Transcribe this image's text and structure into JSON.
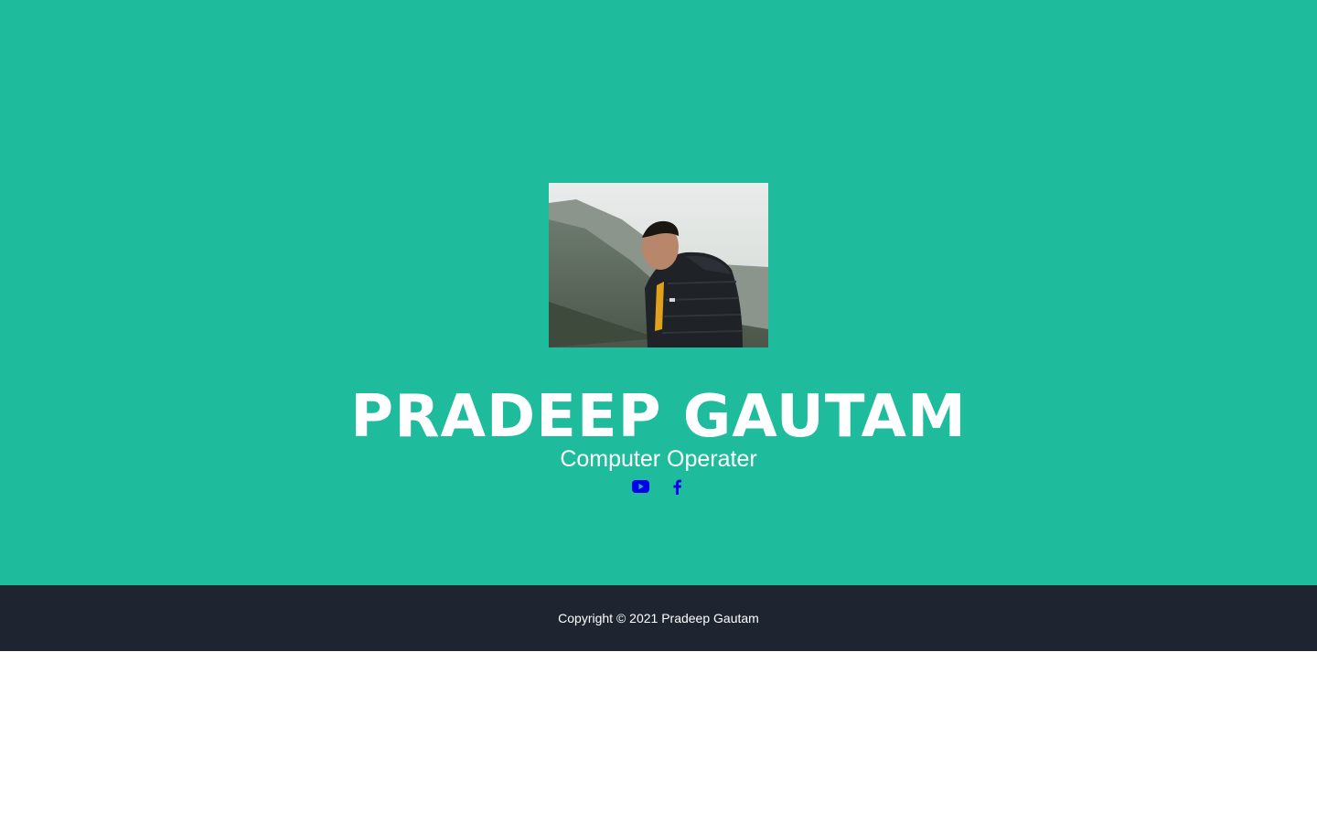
{
  "profile": {
    "photo_alt": "Profile photo",
    "name": "PRADEEP GAUTAM",
    "title": "Computer Operater"
  },
  "social": {
    "icons": [
      "youtube-icon",
      "facebook-icon"
    ],
    "link_color": "#0000ee"
  },
  "footer": {
    "copyright": "Copyright © 2021 Pradeep Gautam"
  },
  "theme": {
    "hero_bg": "#1ebc9c",
    "footer_bg": "#1e2530",
    "text_color": "#ffffff"
  }
}
